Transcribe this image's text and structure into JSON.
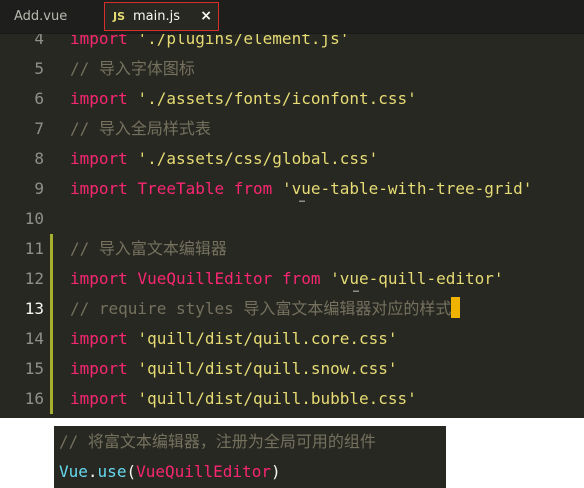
{
  "tabs": [
    {
      "label": "Add.vue",
      "active": false
    },
    {
      "label": "main.js",
      "badge": "JS",
      "close": "×",
      "active": true
    }
  ],
  "lines": [
    {
      "num": "4",
      "parts": [
        [
          "kw",
          "import"
        ],
        [
          "plain",
          " "
        ],
        [
          "str",
          "'./plugins/element.js'"
        ]
      ]
    },
    {
      "num": "5",
      "parts": [
        [
          "cmt",
          "// 导入字体图标"
        ]
      ]
    },
    {
      "num": "6",
      "parts": [
        [
          "kw",
          "import"
        ],
        [
          "plain",
          " "
        ],
        [
          "str",
          "'./assets/fonts/iconfont.css'"
        ]
      ]
    },
    {
      "num": "7",
      "parts": [
        [
          "cmt",
          "// 导入全局样式表"
        ]
      ]
    },
    {
      "num": "8",
      "parts": [
        [
          "kw",
          "import"
        ],
        [
          "plain",
          " "
        ],
        [
          "str",
          "'./assets/css/global.css'"
        ]
      ]
    },
    {
      "num": "9",
      "parts": [
        [
          "kw",
          "import"
        ],
        [
          "plain",
          " "
        ],
        [
          "ident",
          "TreeTable"
        ],
        [
          "plain",
          " "
        ],
        [
          "kw",
          "from"
        ],
        [
          "plain",
          " "
        ],
        [
          "str",
          "'vue-table-with-tree-grid'"
        ]
      ]
    },
    {
      "num": "10",
      "parts": []
    },
    {
      "num": "11",
      "parts": [
        [
          "cmt",
          "// 导入富文本编辑器"
        ]
      ]
    },
    {
      "num": "12",
      "parts": [
        [
          "kw",
          "import"
        ],
        [
          "plain",
          " "
        ],
        [
          "ident",
          "VueQuillEditor"
        ],
        [
          "plain",
          " "
        ],
        [
          "kw",
          "from"
        ],
        [
          "plain",
          " "
        ],
        [
          "str",
          "'vue-quill-editor'"
        ]
      ]
    },
    {
      "num": "13",
      "active": true,
      "parts": [
        [
          "cmt",
          "// require styles 导入富文本编辑器对应的样式"
        ]
      ]
    },
    {
      "num": "14",
      "parts": [
        [
          "kw",
          "import"
        ],
        [
          "plain",
          " "
        ],
        [
          "str",
          "'quill/dist/quill.core.css'"
        ]
      ]
    },
    {
      "num": "15",
      "parts": [
        [
          "kw",
          "import"
        ],
        [
          "plain",
          " "
        ],
        [
          "str",
          "'quill/dist/quill.snow.css'"
        ]
      ]
    },
    {
      "num": "16",
      "parts": [
        [
          "kw",
          "import"
        ],
        [
          "plain",
          " "
        ],
        [
          "str",
          "'quill/dist/quill.bubble.css'"
        ]
      ]
    }
  ],
  "snippet": {
    "comment": "// 将富文本编辑器，注册为全局可用的组件",
    "obj": "Vue",
    "dot": ".",
    "method": "use",
    "open": "(",
    "arg": "VueQuillEditor",
    "close": ")"
  },
  "colors": {
    "editor_bg": "#272822",
    "keyword": "#f92672",
    "string": "#e6db74",
    "comment": "#75715e",
    "function": "#66d9ef",
    "cursor": "#f0b400",
    "active_tab_border": "#d62d2d",
    "modified_marker": "#a6b02c"
  }
}
